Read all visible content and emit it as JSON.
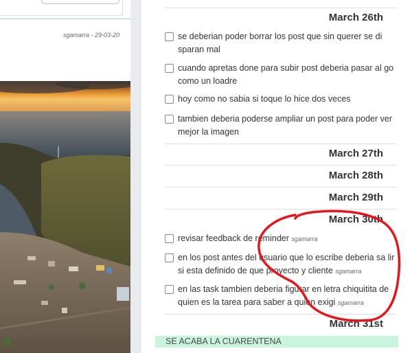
{
  "feed": {
    "post_meta": "sgamarra - 29-03-20"
  },
  "days": [
    {
      "date": "March 26th",
      "tasks": [
        {
          "text": "se deberian poder borrar los post que sin querer se di sparan mal",
          "author": ""
        },
        {
          "text": "cuando apretas done para subir post deberia pasar al go como un loadre",
          "author": ""
        },
        {
          "text": "hoy como no sabia si toque lo hice dos veces",
          "author": ""
        },
        {
          "text": "tambien deberia poderse ampliar un post para poder ver mejor la imagen",
          "author": ""
        }
      ]
    },
    {
      "date": "March 27th",
      "tasks": []
    },
    {
      "date": "March 28th",
      "tasks": []
    },
    {
      "date": "March 29th",
      "tasks": []
    },
    {
      "date": "March 30th",
      "tasks": [
        {
          "text": "revisar feedback de reminder",
          "author": "sgamarra"
        },
        {
          "text": "en los post antes del usuario que lo escribe deberia sa lir si esta definido de que proyecto y cliente",
          "author": "sgamarra"
        },
        {
          "text": "en las task tambien deberia figurar en letra chiquitita de quien es la tarea para saber a quien exigi",
          "author": "sgamarra"
        }
      ]
    },
    {
      "date": "March 31st",
      "tasks": []
    }
  ],
  "banner": "SE ACABA LA CUARENTENA",
  "colors": {
    "banner_bg": "#c9f5df",
    "annotation": "#e8141a",
    "divider_accent": "#9fd1c9"
  },
  "icons": {
    "checkbox": "checkbox-icon"
  }
}
